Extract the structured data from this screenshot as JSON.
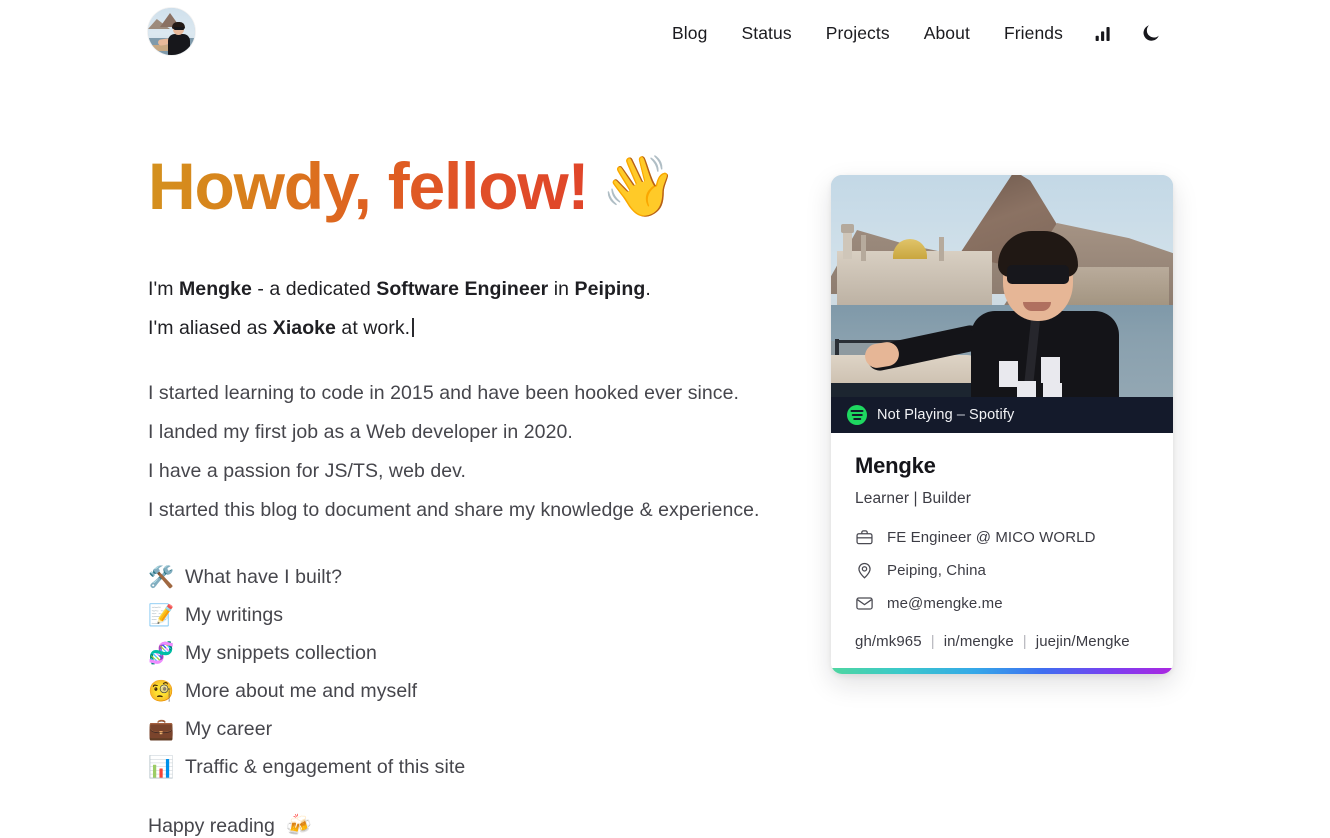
{
  "header": {
    "avatar_alt": "Mengke profile photo",
    "nav": [
      {
        "label": "Blog",
        "name": "nav-blog"
      },
      {
        "label": "Status",
        "name": "nav-status"
      },
      {
        "label": "Projects",
        "name": "nav-projects"
      },
      {
        "label": "About",
        "name": "nav-about"
      },
      {
        "label": "Friends",
        "name": "nav-friends"
      }
    ],
    "icons": {
      "analytics": "bar-chart-icon",
      "theme_toggle": "moon-icon"
    }
  },
  "hero": {
    "heading": "Howdy, fellow!",
    "wave_emoji": "👋",
    "gradient_from": "#d4921e",
    "gradient_to": "#e0452a"
  },
  "intro": {
    "line1_prefix": "I'm ",
    "line1_name": "Mengke",
    "line1_mid": " - a dedicated ",
    "line1_role": "Software Engineer",
    "line1_in": " in ",
    "line1_place": "Peiping",
    "line1_end": ".",
    "line2_prefix": "I'm aliased as ",
    "line2_alias": "Xiaoke",
    "line2_end": " at work."
  },
  "bio": [
    "I started learning to code in 2015 and have been hooked ever since.",
    "I landed my first job as a Web developer in 2020.",
    "I have a passion for JS/TS, web dev.",
    "I started this blog to document and share my knowledge & experience."
  ],
  "links": [
    {
      "emoji": "🛠️",
      "icon_name": "hammer-and-wrench-icon",
      "label": "What have I built?"
    },
    {
      "emoji": "📝",
      "icon_name": "memo-icon",
      "label": "My writings"
    },
    {
      "emoji": "🧬",
      "icon_name": "dna-icon",
      "label": "My snippets collection"
    },
    {
      "emoji": "🧐",
      "icon_name": "face-with-monocle-icon",
      "label": "More about me and myself"
    },
    {
      "emoji": "💼",
      "icon_name": "briefcase-icon",
      "label": "My career"
    },
    {
      "emoji": "📊",
      "icon_name": "bar-chart-emoji-icon",
      "label": "Traffic & engagement of this site"
    }
  ],
  "footer": {
    "happy_text": "Happy reading",
    "happy_emoji": "🍻"
  },
  "card": {
    "spotify": {
      "status": "Not Playing",
      "dash": "–",
      "service": "Spotify",
      "brand_color": "#1ed760"
    },
    "name": "Mengke",
    "tagline": "Learner | Builder",
    "meta": [
      {
        "icon": "briefcase-icon",
        "text": "FE Engineer @ MICO WORLD"
      },
      {
        "icon": "location-pin-icon",
        "text": "Peiping, China"
      },
      {
        "icon": "envelope-icon",
        "text": "me@mengke.me"
      }
    ],
    "social": [
      {
        "label": "gh/mk965"
      },
      {
        "label": "in/mengke"
      },
      {
        "label": "juejin/Mengke"
      }
    ],
    "separator": "|",
    "stripe_colors": [
      "#4fd6a0",
      "#35a8e8",
      "#3f6ef0",
      "#ac27e0"
    ]
  }
}
